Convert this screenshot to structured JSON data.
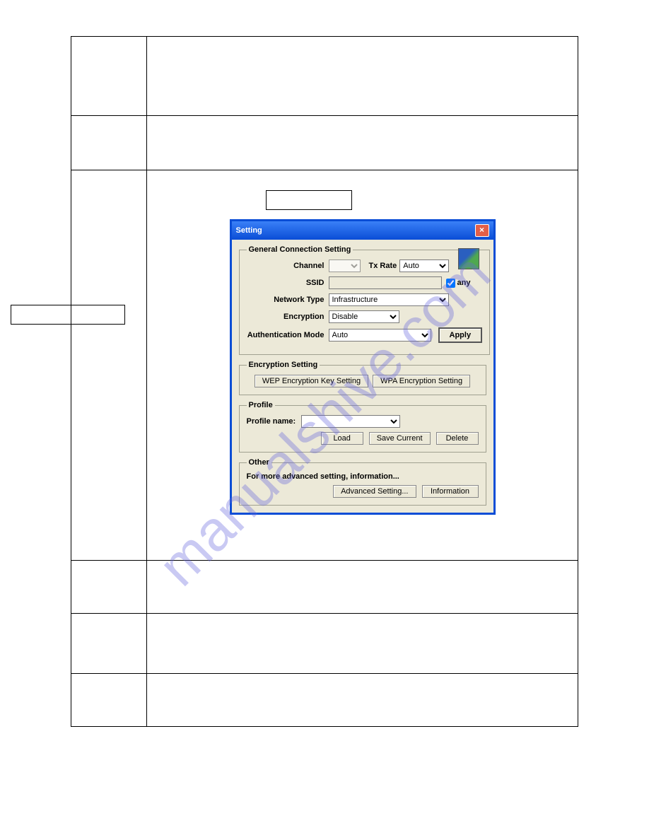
{
  "watermark": "manualshive.com",
  "dialog": {
    "title": "Setting",
    "general": {
      "legend": "General Connection Setting",
      "channel_label": "Channel",
      "channel_value": "",
      "txrate_label": "Tx Rate",
      "txrate_value": "Auto",
      "ssid_label": "SSID",
      "ssid_value": "",
      "any_label": "any",
      "networktype_label": "Network Type",
      "networktype_value": "Infrastructure",
      "encryption_label": "Encryption",
      "encryption_value": "Disable",
      "authmode_label": "Authentication Mode",
      "authmode_value": "Auto",
      "apply_label": "Apply"
    },
    "encryption": {
      "legend": "Encryption Setting",
      "wep_btn": "WEP Encryption Key Setting",
      "wpa_btn": "WPA Encryption Setting"
    },
    "profile": {
      "legend": "Profile",
      "name_label": "Profile name:",
      "name_value": "",
      "load_btn": "Load",
      "save_btn": "Save Current",
      "delete_btn": "Delete"
    },
    "other": {
      "legend": "Other",
      "desc": "For more advanced setting, information...",
      "adv_btn": "Advanced Setting...",
      "info_btn": "Information"
    }
  }
}
